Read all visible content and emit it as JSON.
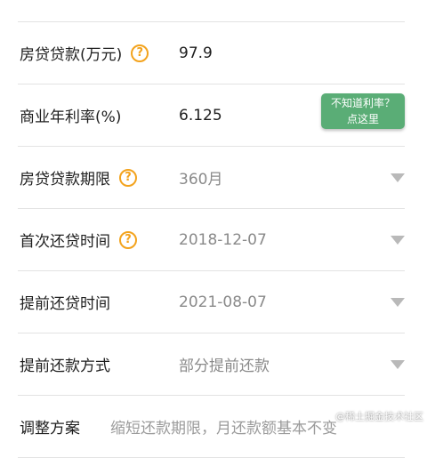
{
  "form": {
    "rows": [
      {
        "label": "房贷贷款(万元)",
        "help": "?",
        "value": "97.9"
      },
      {
        "label": "商业年利率(%)",
        "value": "6.125",
        "hint_line1": "不知道利率？",
        "hint_line2": "点这里"
      },
      {
        "label": "房贷贷款期限",
        "help": "?",
        "value": "360月"
      },
      {
        "label": "首次还贷时间",
        "help": "?",
        "value": "2018-12-07"
      },
      {
        "label": "提前还贷时间",
        "value": "2021-08-07"
      },
      {
        "label": "提前还款方式",
        "value": "部分提前还款"
      },
      {
        "label": "调整方案",
        "value": "缩短还款期限，月还款额基本不变"
      }
    ]
  },
  "watermark": "@稀土掘金技术社区",
  "colors": {
    "help_orange": "#f3a31d",
    "hint_green": "#5aad76",
    "divider": "#e3e3e3",
    "caret": "#b9b9b9"
  },
  "icons": {
    "help": "question-circle-icon",
    "dropdown": "triangle-down-icon"
  }
}
